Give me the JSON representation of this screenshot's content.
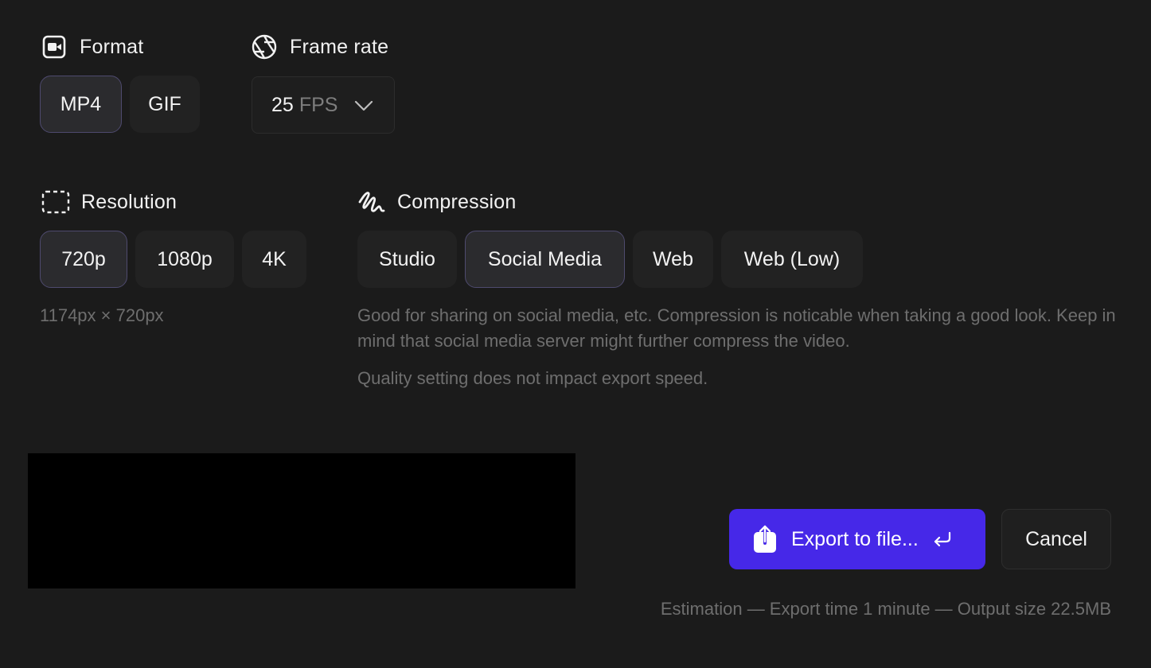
{
  "format": {
    "title": "Format",
    "icon": "video-camera-icon",
    "options": [
      "MP4",
      "GIF"
    ],
    "selected": "MP4"
  },
  "frame_rate": {
    "title": "Frame rate",
    "icon": "aperture-icon",
    "value": "25",
    "unit": "FPS"
  },
  "resolution": {
    "title": "Resolution",
    "icon": "dashed-frame-icon",
    "options": [
      "720p",
      "1080p",
      "4K"
    ],
    "selected": "720p",
    "dimensions": "1174px × 720px"
  },
  "compression": {
    "title": "Compression",
    "icon": "squiggle-icon",
    "options": [
      "Studio",
      "Social Media",
      "Web",
      "Web (Low)"
    ],
    "selected": "Social Media",
    "description": "Good for sharing on social media, etc. Compression is noticable when taking a good look. Keep in mind that social media server might further compress the video.",
    "note": "Quality setting does not impact export speed."
  },
  "actions": {
    "export_label": "Export to file...",
    "cancel_label": "Cancel",
    "accent_color": "#4628e8"
  },
  "estimation": "Estimation — Export time 1 minute — Output size 22.5MB"
}
